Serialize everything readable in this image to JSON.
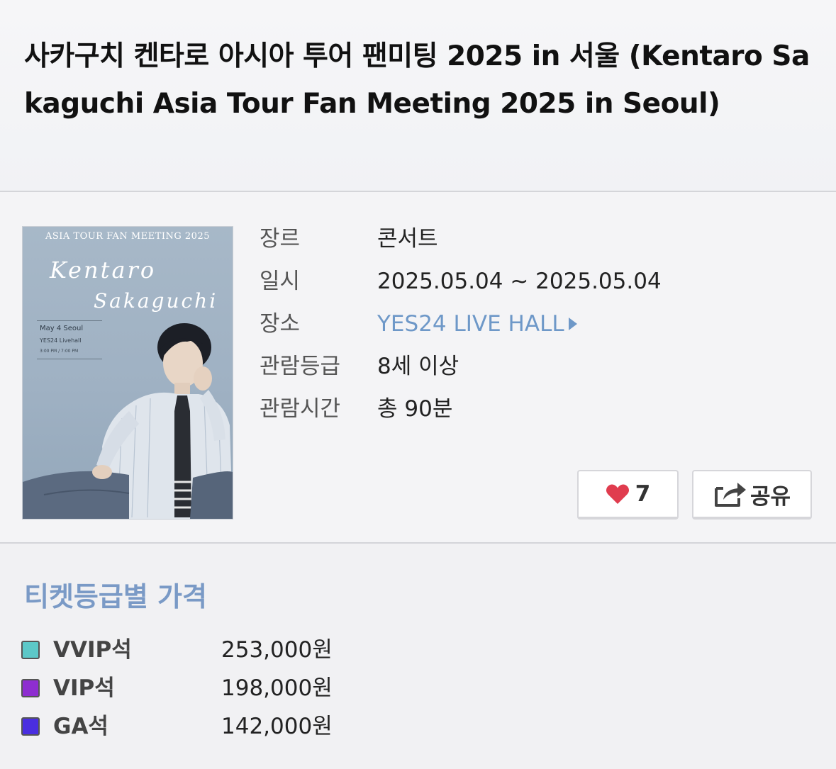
{
  "header": {
    "title": "사카구치 켄타로 아시아 투어 팬미팅 2025 in 서울 (Kentaro Sakaguchi Asia Tour Fan Meeting 2025 in Seoul)"
  },
  "poster": {
    "title": "ASIA TOUR FAN MEETING 2025",
    "script_first": "Kentaro",
    "script_last": "Sakaguchi",
    "date": "May 4 Seoul",
    "venue": "YES24 Livehall",
    "times": "3:00 PM / 7:00 PM"
  },
  "details": [
    {
      "label": "장르",
      "value": "콘서트"
    },
    {
      "label": "일시",
      "value": "2025.05.04 ~ 2025.05.04"
    },
    {
      "label": "장소",
      "value": "YES24 LIVE HALL",
      "link": true
    },
    {
      "label": "관람등급",
      "value": "8세 이상"
    },
    {
      "label": "관람시간",
      "value": "총 90분"
    }
  ],
  "actions": {
    "like_count": "7",
    "like_icon": "heart-icon",
    "share_label": "공유",
    "share_icon": "share-icon"
  },
  "prices": {
    "heading": "티켓등급별 가격",
    "tiers": [
      {
        "name": "VVIP석",
        "price": "253,000원",
        "color": "#5cc8c8"
      },
      {
        "name": "VIP석",
        "price": "198,000원",
        "color": "#8e2ed0"
      },
      {
        "name": "GA석",
        "price": "142,000원",
        "color": "#4a2ee0"
      }
    ]
  },
  "colors": {
    "accent_link": "#6e98c8",
    "heading": "#7a9ac6",
    "heart": "#e03c4e"
  }
}
